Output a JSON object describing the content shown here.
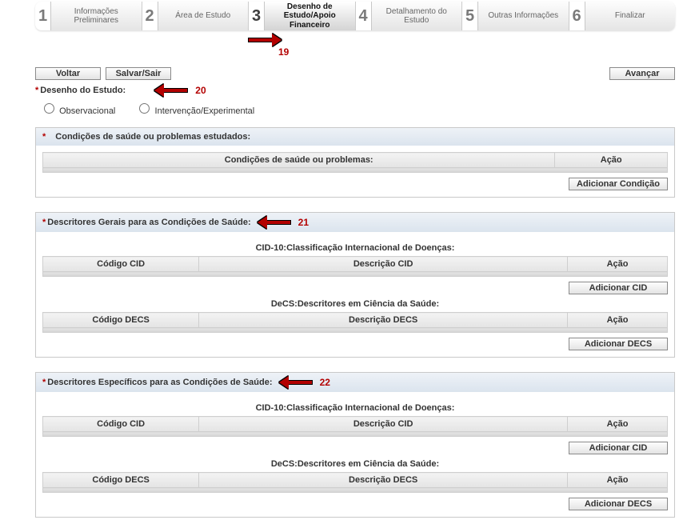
{
  "wizard": [
    {
      "num": "1",
      "label": "Informações Preliminares"
    },
    {
      "num": "2",
      "label": "Área de Estudo"
    },
    {
      "num": "3",
      "label": "Desenho de Estudo/Apoio Financeiro"
    },
    {
      "num": "4",
      "label": "Detalhamento do Estudo"
    },
    {
      "num": "5",
      "label": "Outras Informações"
    },
    {
      "num": "6",
      "label": "Finalizar"
    }
  ],
  "annotations": {
    "a19": "19",
    "a20": "20",
    "a21": "21",
    "a22": "22"
  },
  "toolbar": {
    "voltar": "Voltar",
    "salvar_sair": "Salvar/Sair",
    "avancar": "Avançar"
  },
  "desenho": {
    "label": "Desenho do Estudo:",
    "opt1": "Observacional",
    "opt2": "Intervenção/Experimental"
  },
  "panel_cond": {
    "title": "Condições de saúde ou problemas estudados:",
    "col1": "Condições de saúde ou problemas:",
    "col2": "Ação",
    "btn": "Adicionar Condição"
  },
  "panel_gerais": {
    "title": "Descritores Gerais para as Condições de Saúde:",
    "cid_sub": "CID-10:Classificação Internacional de Doenças:",
    "cid_c1": "Código CID",
    "cid_c2": "Descrição CID",
    "cid_c3": "Ação",
    "cid_btn": "Adicionar CID",
    "decs_sub": "DeCS:Descritores em Ciência da Saúde:",
    "decs_c1": "Código DECS",
    "decs_c2": "Descrição DECS",
    "decs_c3": "Ação",
    "decs_btn": "Adicionar DECS"
  },
  "panel_espec": {
    "title": "Descritores Específicos para as Condições de Saúde:",
    "cid_sub": "CID-10:Classificação Internacional de Doenças:",
    "cid_c1": "Código CID",
    "cid_c2": "Descrição CID",
    "cid_c3": "Ação",
    "cid_btn": "Adicionar CID",
    "decs_sub": "DeCS:Descritores em Ciência da Saúde:",
    "decs_c1": "Código DECS",
    "decs_c2": "Descrição DECS",
    "decs_c3": "Ação",
    "decs_btn": "Adicionar DECS"
  }
}
